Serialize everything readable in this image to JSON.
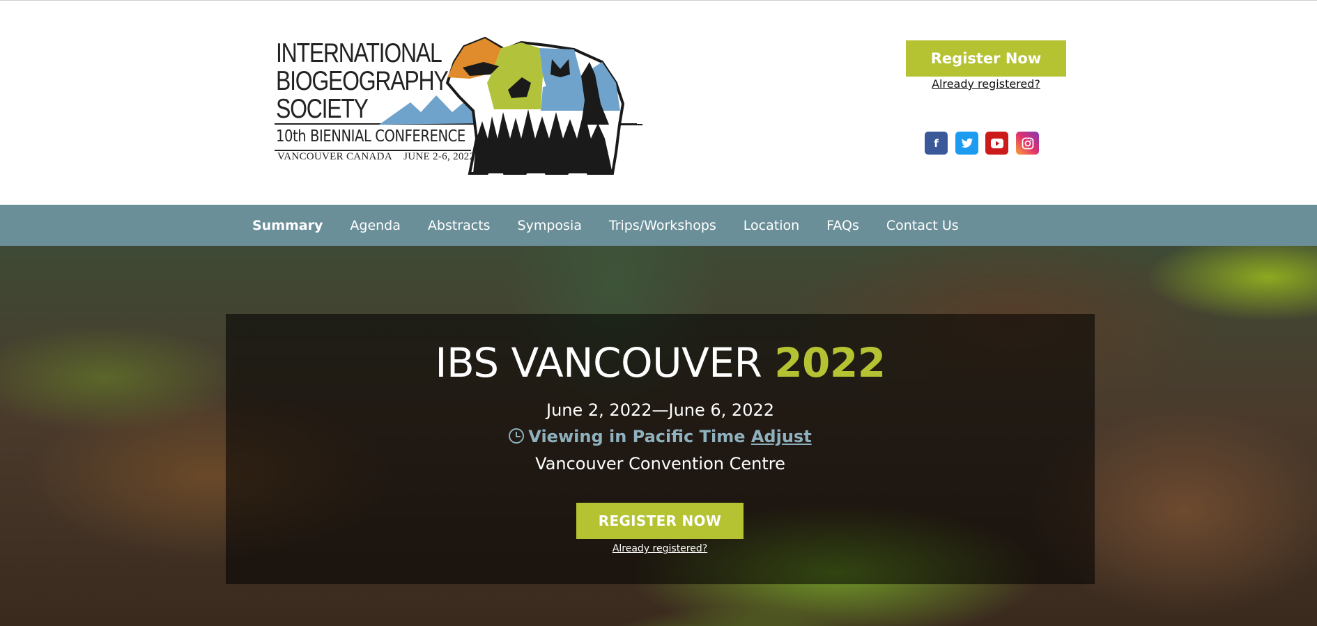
{
  "logo": {
    "lines": [
      "INTERNATIONAL",
      "BIOGEOGRAPHY",
      "SOCIETY"
    ],
    "conference": "10th BIENNIAL CONFERENCE",
    "place": "VANCOUVER CANADA",
    "dates": "JUNE 2-6, 2022"
  },
  "header": {
    "register_label": "Register Now",
    "already_registered": "Already registered?",
    "social": [
      {
        "icon": "facebook-icon",
        "glyph": "f"
      },
      {
        "icon": "twitter-icon",
        "glyph": "🐦"
      },
      {
        "icon": "youtube-icon",
        "glyph": "▶"
      },
      {
        "icon": "instagram-icon",
        "glyph": "◎"
      }
    ]
  },
  "nav": {
    "items": [
      "Summary",
      "Agenda",
      "Abstracts",
      "Symposia",
      "Trips/Workshops",
      "Location",
      "FAQs",
      "Contact Us"
    ],
    "active": "Summary"
  },
  "hero": {
    "title_main": "IBS VANCOUVER ",
    "title_year": "2022",
    "dates": "June 2, 2022—June 6, 2022",
    "timezone_text": "Viewing in Pacific Time",
    "adjust_label": "Adjust",
    "venue": "Vancouver Convention Centre",
    "register_label": "REGISTER NOW",
    "already_registered": "Already registered?"
  },
  "colors": {
    "accent_green": "#b5c332",
    "nav_bg": "#6b8f99",
    "timezone_blue": "#8fb1bd"
  }
}
